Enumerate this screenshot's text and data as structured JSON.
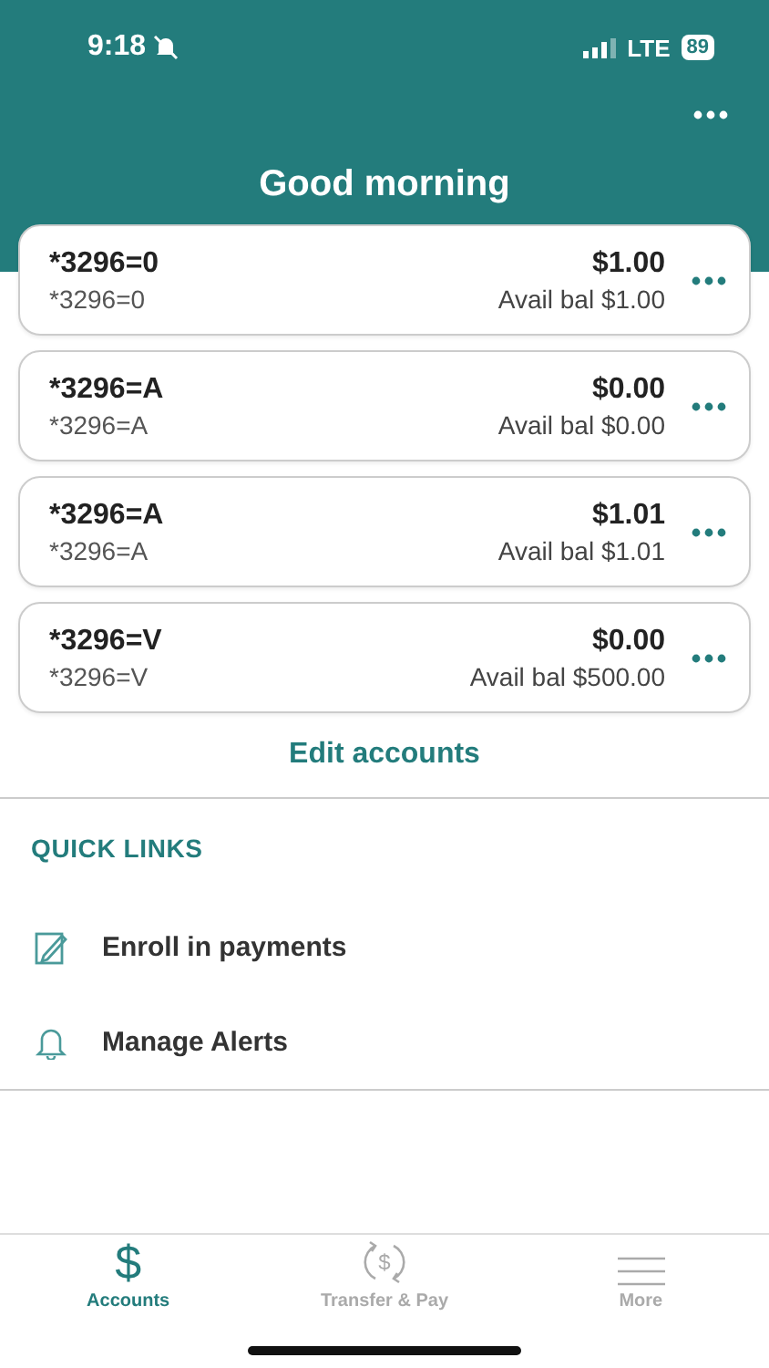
{
  "status_bar": {
    "time": "9:18",
    "network": "LTE",
    "battery": "89"
  },
  "header": {
    "title": "Good morning"
  },
  "accounts": [
    {
      "name": "*3296=0",
      "subtitle": "*3296=0",
      "balance": "$1.00",
      "available": "Avail bal $1.00"
    },
    {
      "name": "*3296=A",
      "subtitle": "*3296=A",
      "balance": "$0.00",
      "available": "Avail bal $0.00"
    },
    {
      "name": "*3296=A",
      "subtitle": "*3296=A",
      "balance": "$1.01",
      "available": "Avail bal $1.01"
    },
    {
      "name": "*3296=V",
      "subtitle": "*3296=V",
      "balance": "$0.00",
      "available": "Avail bal $500.00"
    }
  ],
  "edit_link": "Edit accounts",
  "quick_links": {
    "heading": "QUICK LINKS",
    "items": [
      {
        "label": "Enroll in payments",
        "kind": "edit"
      },
      {
        "label": "Manage Alerts",
        "kind": "bell"
      }
    ]
  },
  "tabs": [
    {
      "label": "Accounts",
      "kind": "dollar",
      "glyph": "$",
      "selected": true
    },
    {
      "label": "Transfer & Pay",
      "kind": "transfer",
      "glyph": "$",
      "selected": false
    },
    {
      "label": "More",
      "kind": "menu",
      "selected": false
    }
  ]
}
